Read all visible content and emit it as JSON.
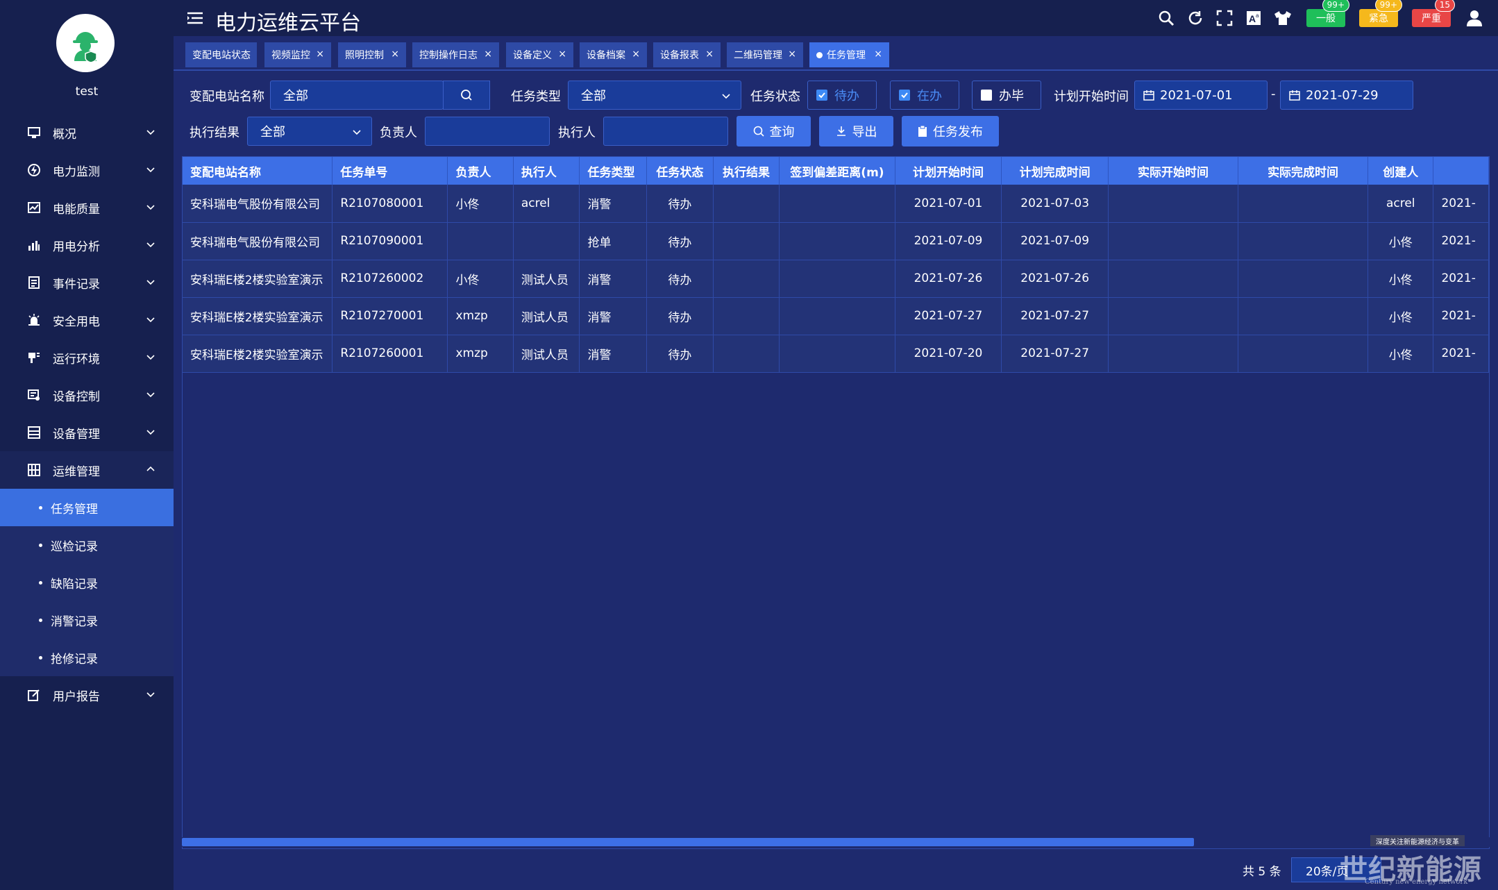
{
  "sidebar": {
    "username": "test",
    "menu": [
      {
        "label": "概况",
        "icon": "monitor-icon"
      },
      {
        "label": "电力监测",
        "icon": "power-icon"
      },
      {
        "label": "电能质量",
        "icon": "quality-icon"
      },
      {
        "label": "用电分析",
        "icon": "bar-chart-icon"
      },
      {
        "label": "事件记录",
        "icon": "record-icon"
      },
      {
        "label": "安全用电",
        "icon": "alarm-icon"
      },
      {
        "label": "运行环境",
        "icon": "environment-icon"
      },
      {
        "label": "设备控制",
        "icon": "control-icon"
      },
      {
        "label": "设备管理",
        "icon": "device-icon"
      },
      {
        "label": "运维管理",
        "icon": "ops-icon"
      }
    ],
    "submenu": [
      "任务管理",
      "巡检记录",
      "缺陷记录",
      "消警记录",
      "抢修记录"
    ],
    "last_menu": {
      "label": "用户报告",
      "icon": "report-icon"
    }
  },
  "header": {
    "title": "电力运维云平台",
    "alerts": [
      {
        "label": "一般",
        "count": "99+",
        "color": "#1fbf5a"
      },
      {
        "label": "紧急",
        "count": "99+",
        "color": "#f5b81c"
      },
      {
        "label": "严重",
        "count": "15",
        "color": "#e84646"
      }
    ]
  },
  "tabs": [
    {
      "label": "变配电站状态",
      "closable": false
    },
    {
      "label": "视频监控",
      "closable": true
    },
    {
      "label": "照明控制",
      "closable": true
    },
    {
      "label": "控制操作日志",
      "closable": true
    },
    {
      "label": "设备定义",
      "closable": true
    },
    {
      "label": "设备档案",
      "closable": true
    },
    {
      "label": "设备报表",
      "closable": true
    },
    {
      "label": "二维码管理",
      "closable": true
    },
    {
      "label": "任务管理",
      "closable": true
    }
  ],
  "filters": {
    "station_label": "变配电站名称",
    "station_value": "全部",
    "task_type_label": "任务类型",
    "task_type_value": "全部",
    "task_status_label": "任务状态",
    "status_options": [
      {
        "label": "待办",
        "checked": true
      },
      {
        "label": "在办",
        "checked": true
      },
      {
        "label": "办毕",
        "checked": false
      }
    ],
    "plan_start_label": "计划开始时间",
    "date_from": "2021-07-01",
    "date_sep": "-",
    "date_to": "2021-07-29",
    "result_label": "执行结果",
    "result_value": "全部",
    "owner_label": "负责人",
    "owner_value": "",
    "executor_label": "执行人",
    "executor_value": "",
    "query_label": "查询",
    "export_label": "导出",
    "publish_label": "任务发布"
  },
  "table": {
    "columns": [
      "变配电站名称",
      "任务单号",
      "负责人",
      "执行人",
      "任务类型",
      "任务状态",
      "执行结果",
      "签到偏差距离(m)",
      "计划开始时间",
      "计划完成时间",
      "实际开始时间",
      "实际完成时间",
      "创建人",
      ""
    ],
    "rows": [
      [
        "安科瑞电气股份有限公司",
        "R2107080001",
        "小佟",
        "acrel",
        "消警",
        "待办",
        "",
        "",
        "2021-07-01",
        "2021-07-03",
        "",
        "",
        "acrel",
        "2021-"
      ],
      [
        "安科瑞电气股份有限公司",
        "R2107090001",
        "",
        "",
        "抢单",
        "待办",
        "",
        "",
        "2021-07-09",
        "2021-07-09",
        "",
        "",
        "小佟",
        "2021-"
      ],
      [
        "安科瑞E楼2楼实验室演示",
        "R2107260002",
        "小佟",
        "测试人员",
        "消警",
        "待办",
        "",
        "",
        "2021-07-26",
        "2021-07-26",
        "",
        "",
        "小佟",
        "2021-"
      ],
      [
        "安科瑞E楼2楼实验室演示",
        "R2107270001",
        "xmzp",
        "测试人员",
        "消警",
        "待办",
        "",
        "",
        "2021-07-27",
        "2021-07-27",
        "",
        "",
        "小佟",
        "2021-"
      ],
      [
        "安科瑞E楼2楼实验室演示",
        "R2107260001",
        "xmzp",
        "测试人员",
        "消警",
        "待办",
        "",
        "",
        "2021-07-20",
        "2021-07-27",
        "",
        "",
        "小佟",
        "2021-"
      ]
    ]
  },
  "pagination": {
    "total": "共 5 条",
    "page_size": "20条/页"
  },
  "watermark": {
    "small": "深度关注新能源经济与变革",
    "main": "世纪新能源网",
    "sub": "Century new energy network"
  }
}
